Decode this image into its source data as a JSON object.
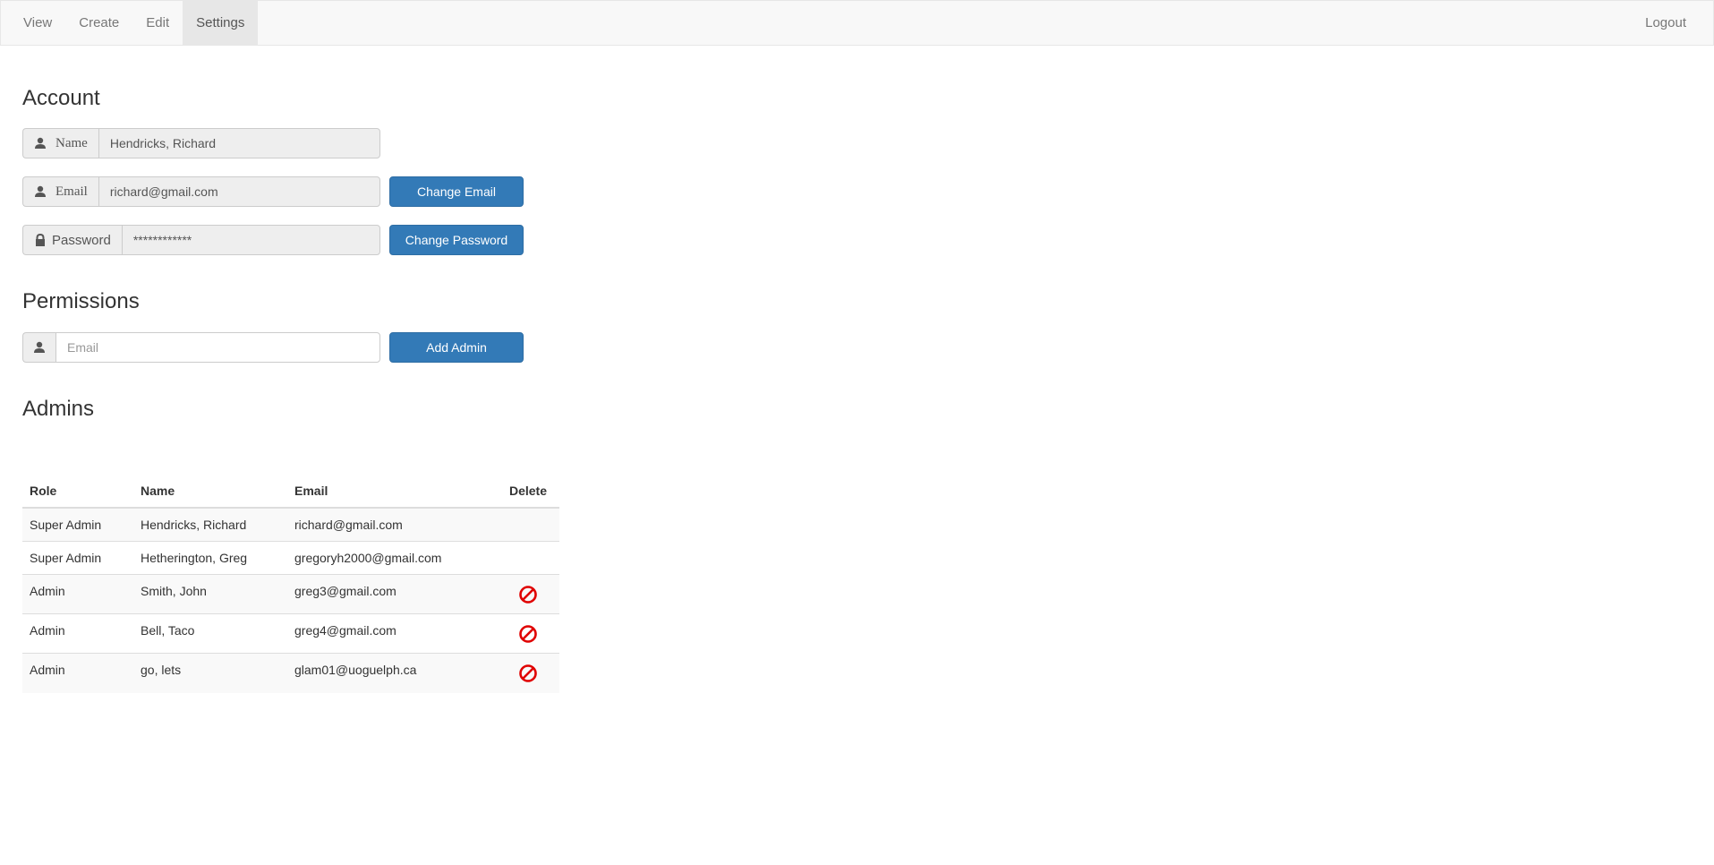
{
  "nav": {
    "tabs": [
      {
        "label": "View"
      },
      {
        "label": "Create"
      },
      {
        "label": "Edit"
      },
      {
        "label": "Settings",
        "active": true
      }
    ],
    "logout": "Logout"
  },
  "account": {
    "heading": "Account",
    "name_label": "Name",
    "name_value": "Hendricks, Richard",
    "email_label": "Email",
    "email_value": "richard@gmail.com",
    "change_email": "Change Email",
    "password_label": "Password",
    "password_value": "************",
    "change_password": "Change Password"
  },
  "permissions": {
    "heading": "Permissions",
    "email_placeholder": "Email",
    "add_admin": "Add Admin"
  },
  "admins": {
    "heading": "Admins",
    "columns": [
      "Role",
      "Name",
      "Email",
      "Delete"
    ],
    "rows": [
      {
        "role": "Super Admin",
        "name": "Hendricks, Richard",
        "email": "richard@gmail.com",
        "deletable": false
      },
      {
        "role": "Super Admin",
        "name": "Hetherington, Greg",
        "email": "gregoryh2000@gmail.com",
        "deletable": false
      },
      {
        "role": "Admin",
        "name": "Smith, John",
        "email": "greg3@gmail.com",
        "deletable": true
      },
      {
        "role": "Admin",
        "name": "Bell, Taco",
        "email": "greg4@gmail.com",
        "deletable": true
      },
      {
        "role": "Admin",
        "name": "go, lets",
        "email": "glam01@uoguelph.ca",
        "deletable": true
      }
    ]
  },
  "icons": {
    "user": "user-icon",
    "lock": "lock-icon",
    "delete": "no-entry-icon"
  },
  "colors": {
    "primary": "#337ab7",
    "delete": "#e00000"
  }
}
